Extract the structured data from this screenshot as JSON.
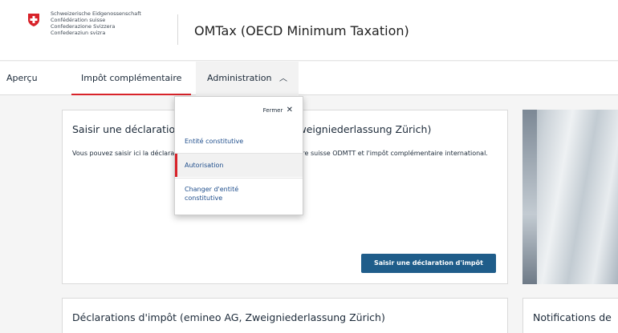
{
  "header": {
    "confederation": [
      "Schweizerische Eidgenossenschaft",
      "Confédération suisse",
      "Confederazione Svizzera",
      "Confederaziun svizra"
    ],
    "app_title": "OMTax (OECD Minimum Taxation)"
  },
  "nav": {
    "items": [
      {
        "label": "Aperçu"
      },
      {
        "label": "Impôt complémentaire"
      },
      {
        "label": "Administration"
      }
    ]
  },
  "dropdown": {
    "close_label": "Fermer",
    "items": [
      {
        "label": "Entité constitutive"
      },
      {
        "label": "Autorisation"
      },
      {
        "label": "Changer d'entité constitutive"
      }
    ]
  },
  "main_card": {
    "title": "Saisir une déclaration d'impôt (emineo AG, Zweigniederlassung Zürich)",
    "text": "Vous pouvez saisir ici la déclaration d'impôt pour l'impôt complémentaire suisse ODMTT et l'impôt complémentaire international.",
    "button_label": "Saisir une déclaration d'impôt"
  },
  "bottom_card": {
    "title": "Déclarations d'impôt (emineo AG, Zweigniederlassung Zürich)"
  },
  "notif_card": {
    "title": "Notifications de"
  },
  "colors": {
    "accent_red": "#d8232a",
    "primary_blue": "#1f5d8a",
    "link_blue": "#1f4e8c"
  }
}
